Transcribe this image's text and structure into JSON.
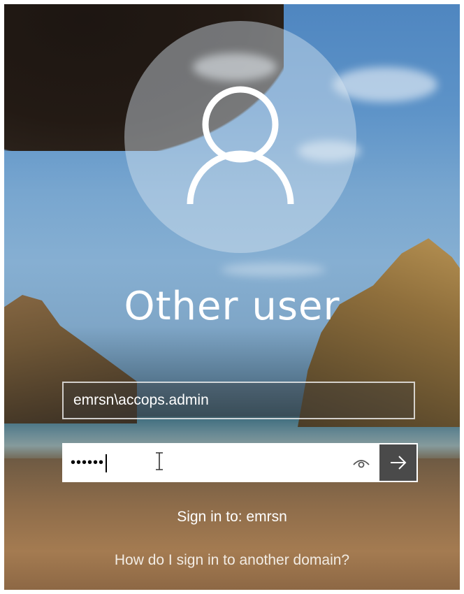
{
  "account": {
    "display_name": "Other user",
    "avatar_icon": "user-silhouette-icon"
  },
  "login_form": {
    "username_value": "emrsn\\accops.admin",
    "password_masked": "••••••",
    "reveal_icon": "eye-icon",
    "submit_icon": "arrow-right-icon"
  },
  "footer": {
    "sign_in_to": "Sign in to: emrsn",
    "other_domain_link": "How do I sign in to another domain?"
  },
  "colors": {
    "submit_button_bg": "#4a4a4a",
    "text": "#ffffff"
  }
}
